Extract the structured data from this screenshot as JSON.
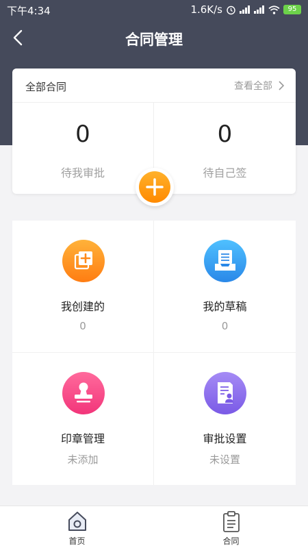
{
  "status_bar": {
    "time": "下午4:34",
    "net_speed": "1.6K/s",
    "battery": "95"
  },
  "nav": {
    "title": "合同管理"
  },
  "summary": {
    "title": "全部合同",
    "view_all": "查看全部",
    "stats": [
      {
        "value": "0",
        "label": "待我审批"
      },
      {
        "value": "0",
        "label": "待自己签"
      }
    ]
  },
  "grid_items": [
    {
      "name": "我创建的",
      "sub": "0",
      "icon": "add-document-icon"
    },
    {
      "name": "我的草稿",
      "sub": "0",
      "icon": "draft-tray-icon"
    },
    {
      "name": "印章管理",
      "sub": "未添加",
      "icon": "stamp-icon"
    },
    {
      "name": "审批设置",
      "sub": "未设置",
      "icon": "approval-document-icon"
    }
  ],
  "tabs": [
    {
      "label": "首页",
      "icon": "home-icon",
      "active": true
    },
    {
      "label": "合同",
      "icon": "clipboard-icon",
      "active": false
    }
  ],
  "colors": {
    "header": "#454a5b",
    "accent": "#ff8a00"
  }
}
